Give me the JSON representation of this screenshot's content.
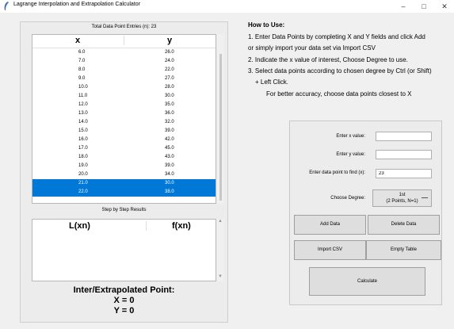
{
  "window": {
    "title": "Lagrange Interpolation and Extrapolation Calculator",
    "minimize": "–",
    "maximize": "□",
    "close": "✕"
  },
  "table": {
    "entries_label": "Total Data Point Entries (n): 23",
    "col_x": "x",
    "col_y": "y",
    "rows": [
      {
        "x": "6.0",
        "y": "26.0",
        "selected": false
      },
      {
        "x": "7.0",
        "y": "24.0",
        "selected": false
      },
      {
        "x": "8.0",
        "y": "22.0",
        "selected": false
      },
      {
        "x": "9.0",
        "y": "27.0",
        "selected": false
      },
      {
        "x": "10.0",
        "y": "28.0",
        "selected": false
      },
      {
        "x": "11.0",
        "y": "30.0",
        "selected": false
      },
      {
        "x": "12.0",
        "y": "35.0",
        "selected": false
      },
      {
        "x": "13.0",
        "y": "36.0",
        "selected": false
      },
      {
        "x": "14.0",
        "y": "32.0",
        "selected": false
      },
      {
        "x": "15.0",
        "y": "39.0",
        "selected": false
      },
      {
        "x": "16.0",
        "y": "42.0",
        "selected": false
      },
      {
        "x": "17.0",
        "y": "45.0",
        "selected": false
      },
      {
        "x": "18.0",
        "y": "43.0",
        "selected": false
      },
      {
        "x": "19.0",
        "y": "39.0",
        "selected": false
      },
      {
        "x": "20.0",
        "y": "34.0",
        "selected": false
      },
      {
        "x": "21.0",
        "y": "30.0",
        "selected": true
      },
      {
        "x": "22.0",
        "y": "38.0",
        "selected": true
      }
    ]
  },
  "steps": {
    "title": "Step by Step Results",
    "col_l": "L(xn)",
    "col_f": "f(xn)"
  },
  "result": {
    "heading": "Inter/Extrapolated Point:",
    "x_line": "X = 0",
    "y_line": "Y = 0"
  },
  "howto": {
    "title": "How to Use:",
    "lines": [
      "1. Enter Data Points by completing X and Y fields and click Add",
      "or simply import your data set via Import CSV",
      "2. Indicate the x value of interest, Choose Degree to use.",
      "3. Select data points according to chosen degree by Ctrl (or Shift)",
      "+ Left Click.",
      "For better accuracy, choose data points closest to X"
    ]
  },
  "form": {
    "x_label": "Enter x value:",
    "x_value": "",
    "y_label": "Enter y value:",
    "y_value": "",
    "find_label": "Enter data point to find (x):",
    "find_value": "23",
    "degree_label": "Choose Degree:",
    "degree_line1": "1st",
    "degree_line2": "(2 Points, N=1)",
    "add_button": "Add Data",
    "delete_button": "Delete Data",
    "import_button": "Import CSV",
    "empty_button": "Empty Table",
    "calculate_button": "Calculate"
  },
  "colors": {
    "selection": "#0078d7",
    "background": "#f0f0f0"
  }
}
